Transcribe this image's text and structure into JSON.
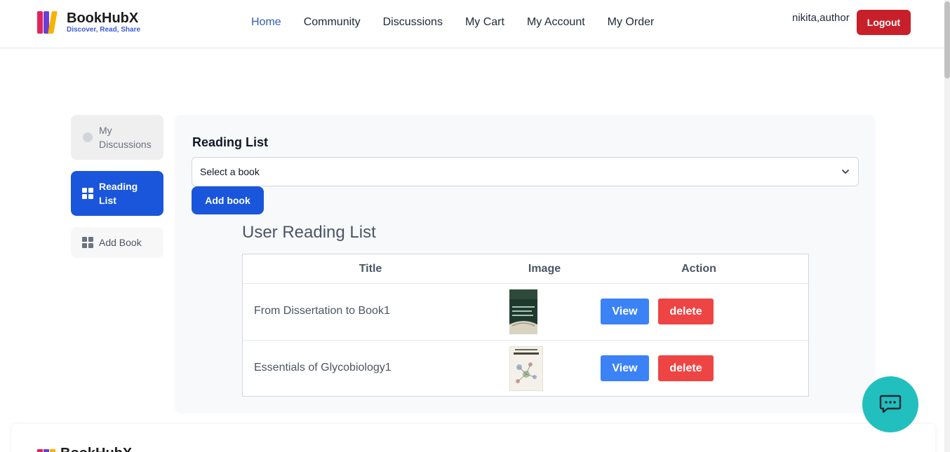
{
  "brand": {
    "name": "BookHubX",
    "tagline": "Discover, Read, Share"
  },
  "nav": {
    "items": [
      {
        "label": "Home",
        "active": true
      },
      {
        "label": "Community"
      },
      {
        "label": "Discussions"
      },
      {
        "label": "My Cart"
      },
      {
        "label": "My Account"
      },
      {
        "label": "My Order"
      }
    ]
  },
  "user": {
    "name": "nikita,author",
    "logout_label": "Logout"
  },
  "sidebar": {
    "items": [
      {
        "label": "My Discussions",
        "icon": "user-circle-icon"
      },
      {
        "label": "Reading List",
        "icon": "grid-icon",
        "active": true
      },
      {
        "label": "Add Book",
        "icon": "grid-icon"
      }
    ]
  },
  "reading_list": {
    "title": "Reading List",
    "select_placeholder": "Select a book",
    "add_label": "Add book"
  },
  "user_list": {
    "title": "User Reading List",
    "columns": [
      "Title",
      "Image",
      "Action"
    ],
    "rows": [
      {
        "title": "From Dissertation to Book1",
        "view_label": "View",
        "delete_label": "delete"
      },
      {
        "title": "Essentials of Glycobiology1",
        "view_label": "View",
        "delete_label": "delete"
      }
    ]
  },
  "footer": {
    "brand": "BookHubX"
  },
  "colors": {
    "primary": "#1a56db",
    "logout": "#c8202a",
    "view": "#3b82f6",
    "delete": "#ef4444",
    "chat": "#22bfbf",
    "nav_active": "#2f5fb3"
  }
}
